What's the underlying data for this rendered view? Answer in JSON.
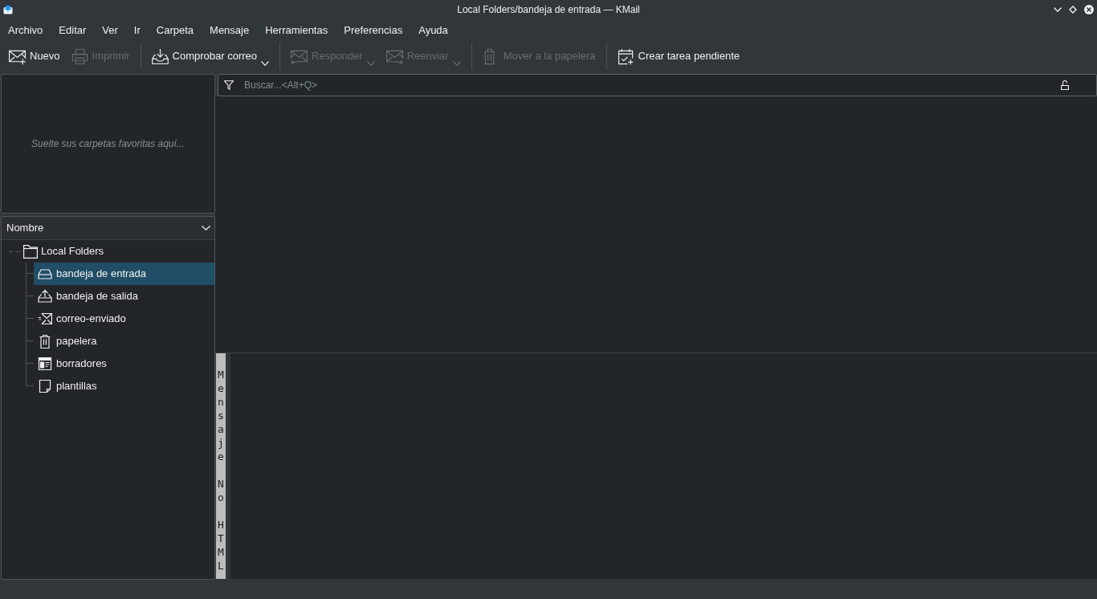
{
  "window": {
    "title": "Local Folders/bandeja de entrada — KMail"
  },
  "menu": [
    "Archivo",
    "Editar",
    "Ver",
    "Ir",
    "Carpeta",
    "Mensaje",
    "Herramientas",
    "Preferencias",
    "Ayuda"
  ],
  "toolbar": [
    {
      "kind": "button",
      "label": "Nuevo",
      "disabled": false
    },
    {
      "kind": "button",
      "label": "Imprimir",
      "disabled": true
    },
    {
      "kind": "separator"
    },
    {
      "kind": "menu_button",
      "label": "Comprobar correo",
      "disabled": false
    },
    {
      "kind": "separator"
    },
    {
      "kind": "menu_button",
      "label": "Responder",
      "disabled": true
    },
    {
      "kind": "menu_button",
      "label": "Reenviar",
      "disabled": true
    },
    {
      "kind": "separator"
    },
    {
      "kind": "button",
      "label": "Mover a la papelera",
      "disabled": true
    },
    {
      "kind": "separator"
    },
    {
      "kind": "button",
      "label": "Crear tarea pendiente",
      "disabled": false
    }
  ],
  "favorites": {
    "hint": "Suelte sus carpetas favoritas aquí..."
  },
  "folder_tree": {
    "header": "Nombre",
    "folders": [
      {
        "label": "Local Folders",
        "expanded": true,
        "selected": false,
        "children": [
          {
            "label": "bandeja de entrada",
            "selected": true
          },
          {
            "label": "bandeja de salida",
            "selected": false
          },
          {
            "label": "correo-enviado",
            "selected": false
          },
          {
            "label": "papelera",
            "selected": false
          },
          {
            "label": "borradores",
            "selected": false
          },
          {
            "label": "plantillas",
            "selected": false
          }
        ]
      }
    ]
  },
  "search": {
    "placeholder": "Buscar...<Alt+Q>"
  },
  "message_viewer": {
    "banner": "Mensaje No HTML"
  }
}
